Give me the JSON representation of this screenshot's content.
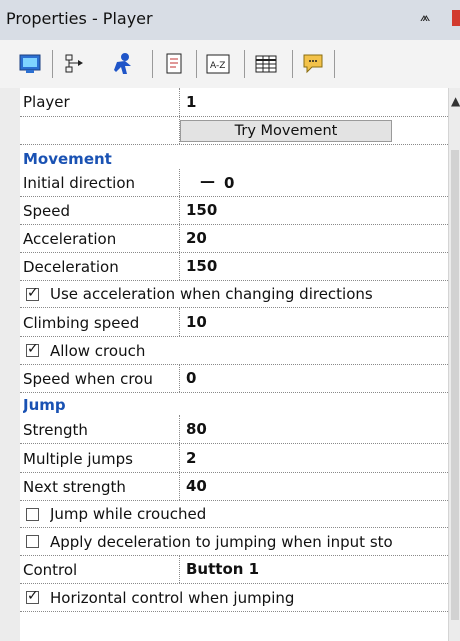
{
  "window": {
    "title": "Properties - Player",
    "pin_glyph": "ᵖ"
  },
  "toolbar": {
    "icons": [
      "properties-screen-icon",
      "events-icon",
      "behavior-icon",
      "document-icon",
      "sort-az-icon",
      "grid-icon",
      "comment-icon"
    ]
  },
  "grid": {
    "player_row": {
      "label": "Player",
      "value": "1"
    },
    "try_button": "Try Movement",
    "movement_header": "Movement",
    "initial_direction": {
      "label": "Initial direction",
      "value": "0",
      "dash": "—"
    },
    "speed": {
      "label": "Speed",
      "value": "150"
    },
    "acceleration": {
      "label": "Acceleration",
      "value": "20"
    },
    "deceleration": {
      "label": "Deceleration",
      "value": "150"
    },
    "use_accel_dir": {
      "label": "Use acceleration when changing directions",
      "checked": true
    },
    "climbing_speed": {
      "label": "Climbing speed",
      "value": "10"
    },
    "allow_crouch": {
      "label": "Allow crouch",
      "checked": true
    },
    "speed_crouch": {
      "label": "Speed when crou",
      "value": "0"
    },
    "jump_header": "Jump",
    "strength": {
      "label": "Strength",
      "value": "80"
    },
    "multiple_jumps": {
      "label": "Multiple jumps",
      "value": "2"
    },
    "next_strength": {
      "label": "Next strength",
      "value": "40"
    },
    "jump_crouched": {
      "label": "Jump while crouched",
      "checked": false
    },
    "apply_decel_jump": {
      "label": "Apply deceleration to jumping when input sto",
      "checked": false
    },
    "control": {
      "label": "Control",
      "value": "Button 1"
    },
    "horizontal_control": {
      "label": "Horizontal control when jumping",
      "checked": true
    }
  },
  "glyphs": {
    "tick": "✓",
    "caret": "▲"
  }
}
